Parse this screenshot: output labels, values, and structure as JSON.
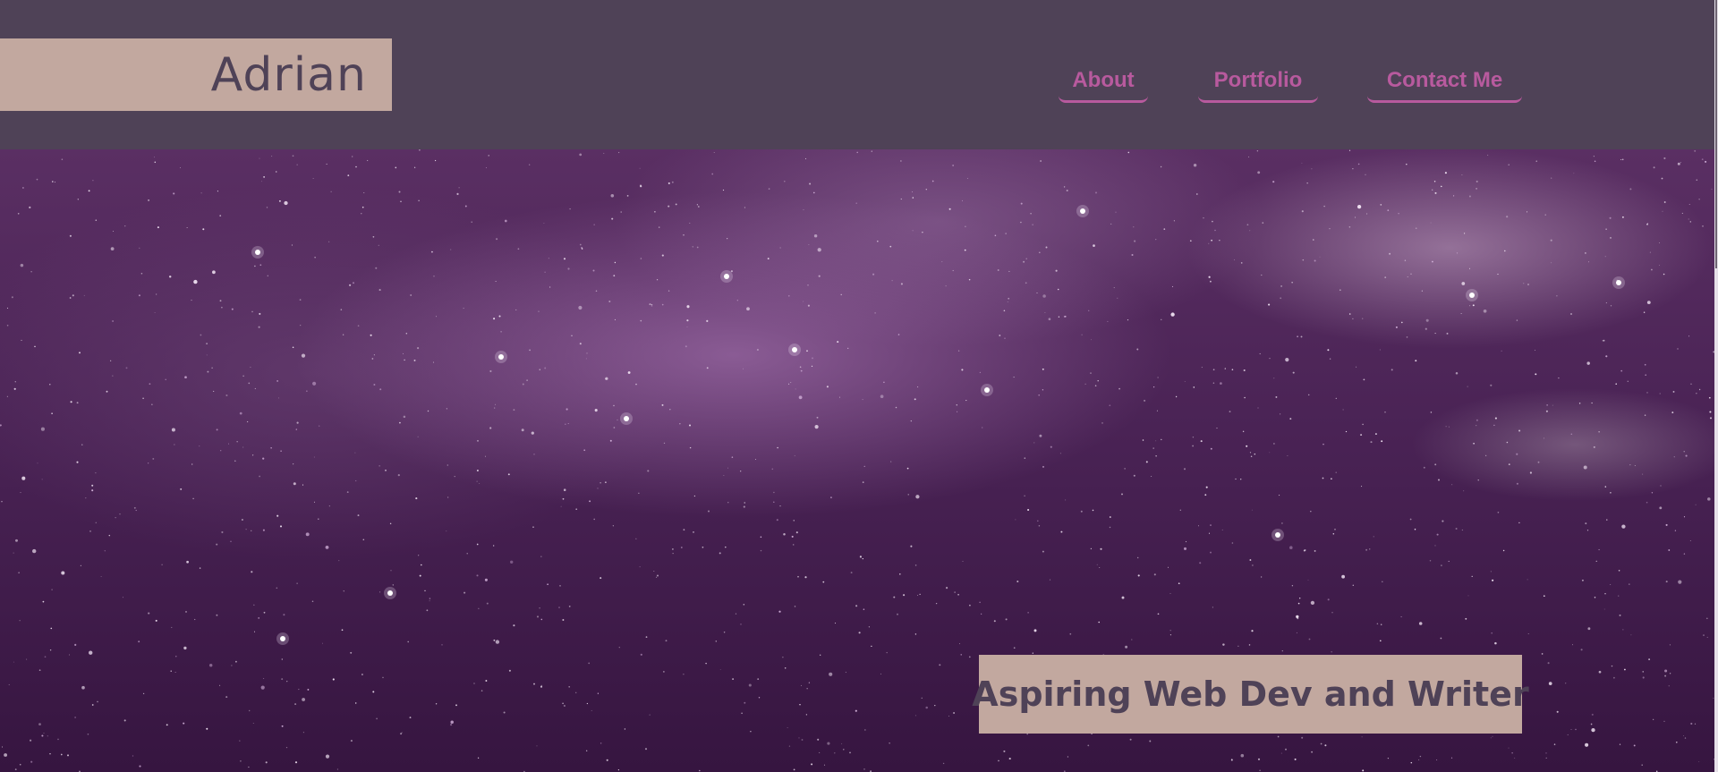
{
  "header": {
    "logo_text": "Adrian",
    "nav": {
      "about": "About",
      "portfolio": "Portfolio",
      "contact": "Contact Me"
    }
  },
  "hero": {
    "background": "starfield-milky-way",
    "tagline": "Aspiring Web Dev and Writer"
  },
  "colors": {
    "header_bg": "#4f4257",
    "accent_box": "#c2a89f",
    "nav_link": "#b85a9e",
    "text_dark": "#4f4257"
  }
}
